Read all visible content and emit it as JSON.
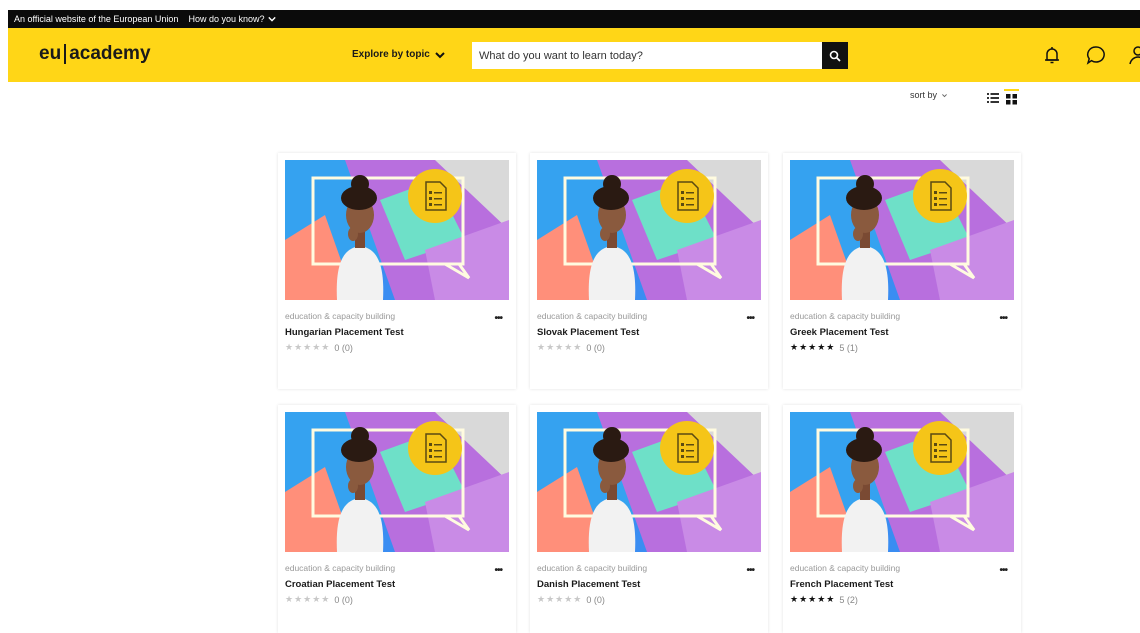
{
  "eu_bar": {
    "official_text": "An official website of the European Union",
    "how_text": "How do you know?"
  },
  "header": {
    "logo_left": "eu",
    "logo_right": "academy",
    "explore_label": "Explore by topic",
    "search_placeholder": "What do you want to learn today?"
  },
  "toolbar": {
    "sort_label": "sort by"
  },
  "cards": [
    {
      "category": "education & capacity building",
      "title": "Hungarian Placement Test",
      "stars": "★★★★★",
      "rating_text": "0 (0)",
      "rated": false
    },
    {
      "category": "education & capacity building",
      "title": "Slovak Placement Test",
      "stars": "★★★★★",
      "rating_text": "0 (0)",
      "rated": false
    },
    {
      "category": "education & capacity building",
      "title": "Greek Placement Test",
      "stars": "★★★★★",
      "rating_text": "5 (1)",
      "rated": true
    },
    {
      "category": "education & capacity building",
      "title": "Croatian Placement Test",
      "stars": "★★★★★",
      "rating_text": "0 (0)",
      "rated": false
    },
    {
      "category": "education & capacity building",
      "title": "Danish Placement Test",
      "stars": "★★★★★",
      "rating_text": "0 (0)",
      "rated": false
    },
    {
      "category": "education & capacity building",
      "title": "French Placement Test",
      "stars": "★★★★★",
      "rating_text": "5 (2)",
      "rated": true
    }
  ],
  "more_label": "•••",
  "colors": {
    "brand_yellow": "#ffd617",
    "eu_bar": "#0b0b0b"
  },
  "icons": [
    "chevron-down-icon",
    "search-icon",
    "bell-icon",
    "chat-icon",
    "user-icon",
    "list-view-icon",
    "grid-view-icon",
    "document-checklist-icon"
  ]
}
